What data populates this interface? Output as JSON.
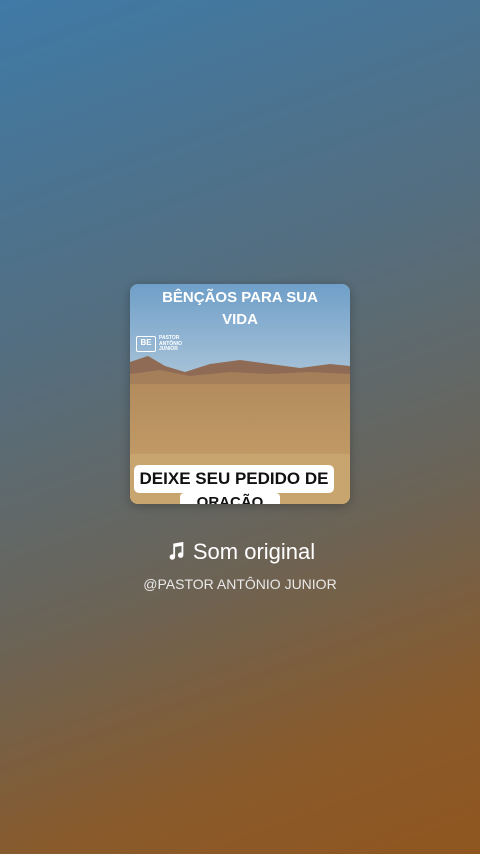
{
  "card": {
    "top_caption_line1": "BÊNÇÃOS PARA SUA",
    "top_caption_line2": "VIDA",
    "logo_mark": "BE",
    "logo_line1": "PASTOR",
    "logo_line2": "ANTÔNIO",
    "logo_line3": "JUNIOR",
    "bottom_caption": "DEIXE SEU PEDIDO DE",
    "bottom_caption_cut": "ORAÇÃO"
  },
  "sound": {
    "icon": "music-note-icon",
    "label": "Som original"
  },
  "handle": "@PASTOR ANTÔNIO JUNIOR",
  "colors": {
    "background_top": "#3f7aa6",
    "background_bottom": "#8f5620",
    "text": "#ffffff"
  }
}
